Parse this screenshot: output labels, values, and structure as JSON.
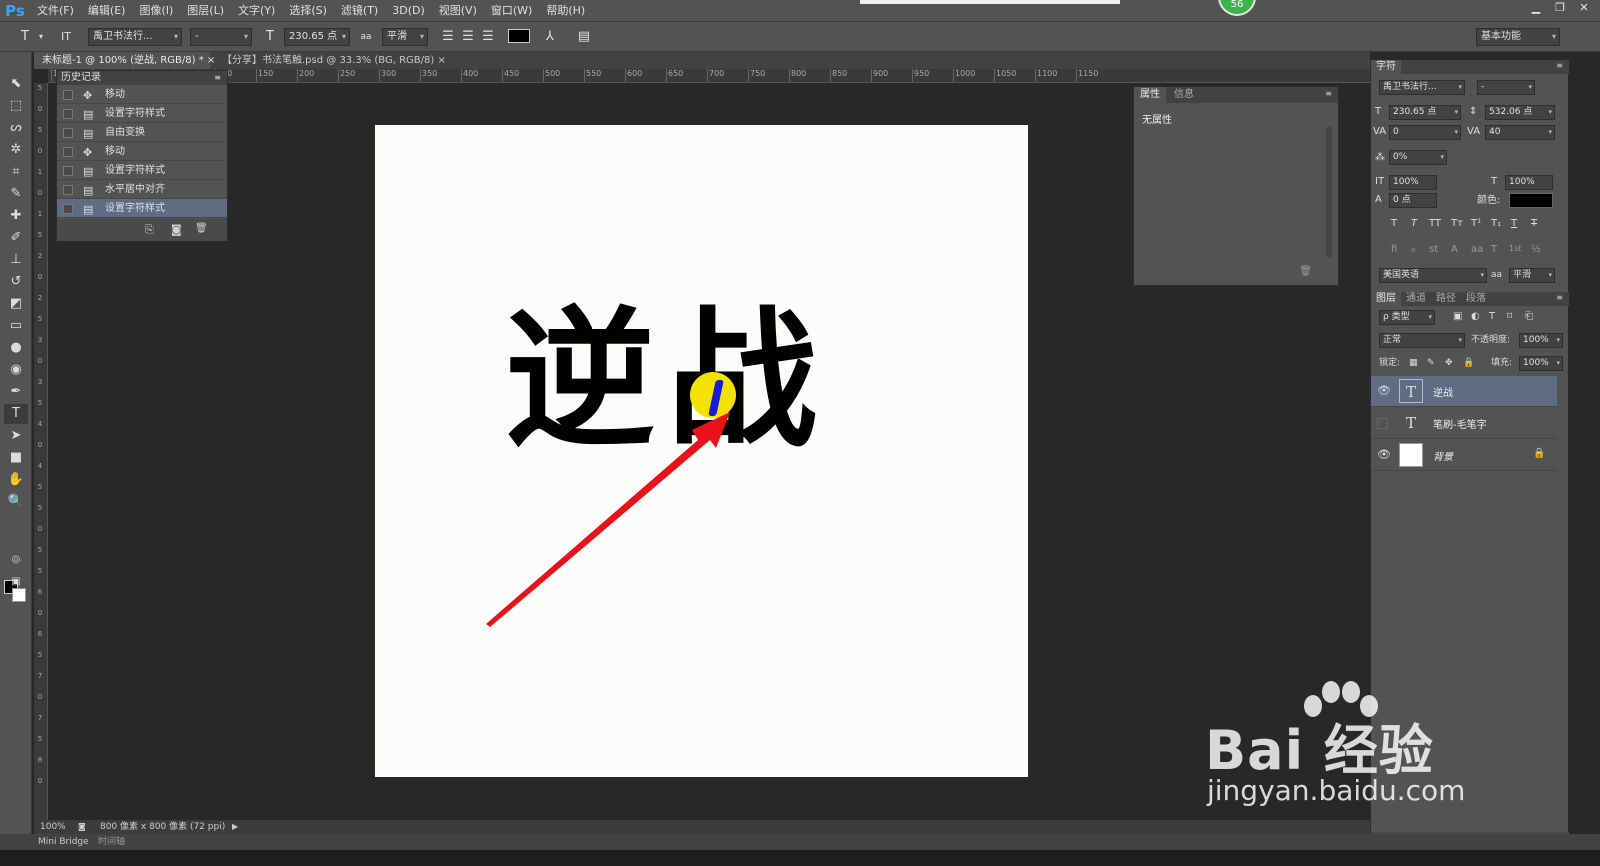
{
  "app": {
    "logo": "Ps",
    "badge": "56"
  },
  "menu": [
    "文件(F)",
    "编辑(E)",
    "图像(I)",
    "图层(L)",
    "文字(Y)",
    "选择(S)",
    "滤镜(T)",
    "3D(D)",
    "视图(V)",
    "窗口(W)",
    "帮助(H)"
  ],
  "window_controls": {
    "minimize": "▁",
    "restore": "❐",
    "close": "✕"
  },
  "options": {
    "tool_icon": "T",
    "orient_icon": "IT",
    "font_family": "禹卫书法行...",
    "font_style": "-",
    "font_size_icon": "T",
    "font_size": "230.65 点",
    "aa_icon": "aa",
    "anti_alias": "平滑",
    "commit_icon": "✓",
    "workspace": "基本功能",
    "text_color": "#000000"
  },
  "doc_tabs": [
    {
      "label": "未标题-1 @ 100% (逆战, RGB/8) *",
      "close": "×"
    },
    {
      "label": "【分享】书法笔触.psd @ 33.3% (BG, RGB/8)",
      "close": "×"
    }
  ],
  "ruler": {
    "h_ticks": [
      "100",
      "50",
      "0",
      "50",
      "100",
      "150",
      "200",
      "250",
      "300",
      "350",
      "400",
      "450",
      "500",
      "550",
      "600",
      "650",
      "700",
      "750",
      "800",
      "850",
      "900",
      "950",
      "1000",
      "1050",
      "1100",
      "1150"
    ],
    "v_ticks": [
      "5",
      "0",
      "5",
      "0",
      "1",
      "0",
      "1",
      "5",
      "2",
      "0",
      "2",
      "5",
      "3",
      "0",
      "3",
      "5",
      "4",
      "0",
      "4",
      "5",
      "5",
      "0",
      "5",
      "5",
      "6",
      "0",
      "6",
      "5",
      "7",
      "0",
      "7",
      "5",
      "8",
      "0"
    ]
  },
  "history": {
    "title": "历史记录",
    "items": [
      {
        "icon": "✥",
        "label": "移动"
      },
      {
        "icon": "▤",
        "label": "设置字符样式"
      },
      {
        "icon": "▤",
        "label": "自由变换"
      },
      {
        "icon": "✥",
        "label": "移动"
      },
      {
        "icon": "▤",
        "label": "设置字符样式"
      },
      {
        "icon": "▤",
        "label": "水平居中对齐"
      },
      {
        "icon": "▤",
        "label": "设置字符样式"
      }
    ],
    "footer_icons": [
      "⎘",
      "◙",
      "🗑"
    ]
  },
  "properties": {
    "tabs": [
      "属性",
      "信息"
    ],
    "content": "无属性"
  },
  "canvas": {
    "text": "逆战",
    "arrow_color": "#e8121a",
    "highlight_color": "#f4e200"
  },
  "character": {
    "title": "字符",
    "font_family": "禹卫书法行...",
    "font_style": "-",
    "size": "230.65 点",
    "leading": "532.06 点",
    "kerning": "0",
    "tracking": "40",
    "scale_tsume": "0%",
    "v_scale": "100%",
    "h_scale": "100%",
    "baseline": "0 点",
    "color_label": "颜色:",
    "style_buttons": [
      "T",
      "T",
      "TT",
      "Tт",
      "T¹",
      "T₁",
      "T",
      "T"
    ],
    "ot_buttons": [
      "fi",
      "ℴ",
      "st",
      "A",
      "aa",
      "T",
      "1st",
      "½"
    ],
    "language": "美国英语",
    "aa": "平滑"
  },
  "layers": {
    "tabs": [
      "图层",
      "通道",
      "路径",
      "段落"
    ],
    "filter": "ρ 类型",
    "blend_mode": "正常",
    "opacity_label": "不透明度:",
    "opacity": "100%",
    "lock_label": "锁定:",
    "fill_label": "填充:",
    "fill": "100%",
    "items": [
      {
        "name": "逆战",
        "kind": "T",
        "visible": true
      },
      {
        "name": "笔刷-毛笔字",
        "kind": "T",
        "visible": false
      },
      {
        "name": "背景",
        "kind": "bg",
        "visible": true
      }
    ]
  },
  "status": {
    "zoom": "100%",
    "doc_info": "800 像素 x 800 像素 (72 ppi)"
  },
  "bottom_tabs": [
    "Mini Bridge",
    "时间轴"
  ],
  "watermark": {
    "main": "Bai 经验",
    "url": "jingyan.baidu.com"
  }
}
